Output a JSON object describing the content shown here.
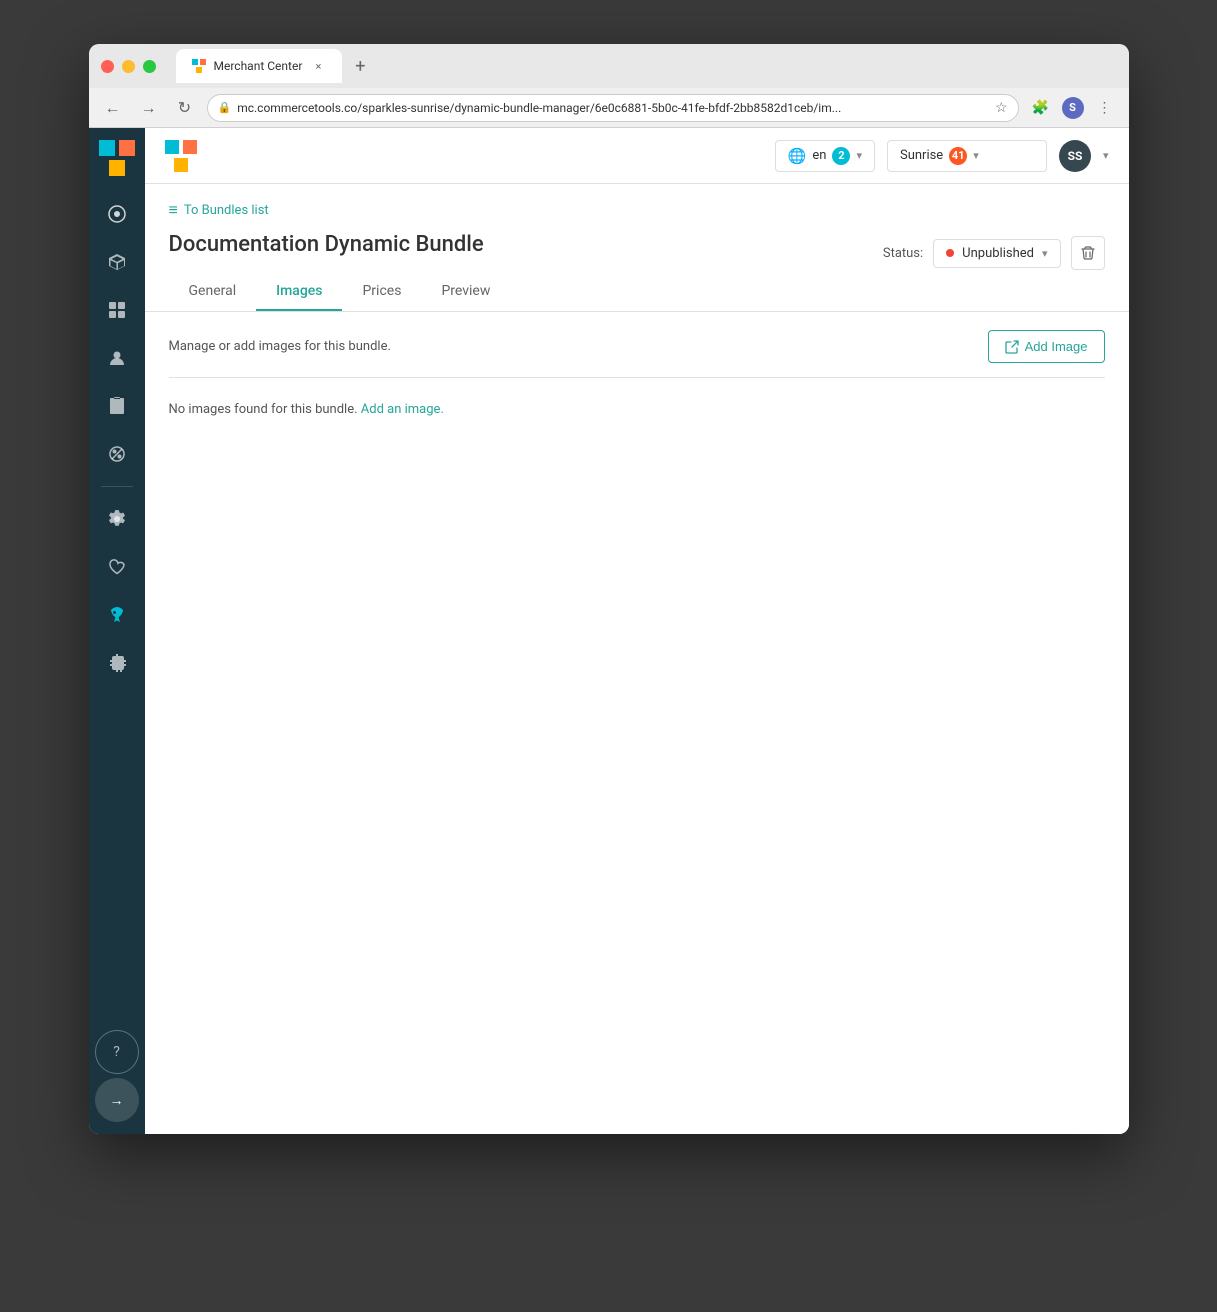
{
  "browser": {
    "tab_title": "Merchant Center",
    "url": "mc.commercetools.co/sparkles-sunrise/dynamic-bundle-manager/6e0c6881-5b0c-41fe-bfdf-2bb8582d1ceb/im...",
    "tab_close": "×",
    "tab_new": "+"
  },
  "topnav": {
    "lang": "en",
    "lang_count": "2",
    "project_name": "Sunrise",
    "project_count": "41",
    "user_initials": "SS"
  },
  "breadcrumb": {
    "icon": "≡",
    "label": "To Bundles list"
  },
  "page": {
    "title": "Documentation Dynamic Bundle",
    "tabs": [
      {
        "id": "general",
        "label": "General"
      },
      {
        "id": "images",
        "label": "Images"
      },
      {
        "id": "prices",
        "label": "Prices"
      },
      {
        "id": "preview",
        "label": "Preview"
      }
    ],
    "active_tab": "images",
    "status_label": "Status:",
    "status_value": "Unpublished",
    "body_description": "Manage or add images for this bundle.",
    "add_image_label": "Add Image",
    "empty_state": "No images found for this bundle.",
    "empty_link": "Add an image."
  },
  "sidebar": {
    "items": [
      {
        "id": "dashboard",
        "icon": "◉",
        "label": "Dashboard"
      },
      {
        "id": "products",
        "icon": "⬡",
        "label": "Products"
      },
      {
        "id": "categories",
        "icon": "⊞",
        "label": "Categories"
      },
      {
        "id": "customers",
        "icon": "👤",
        "label": "Customers"
      },
      {
        "id": "orders",
        "icon": "🛒",
        "label": "Orders"
      },
      {
        "id": "discounts",
        "icon": "🏷",
        "label": "Discounts"
      }
    ],
    "bottom_items": [
      {
        "id": "settings",
        "icon": "⚙",
        "label": "Settings"
      },
      {
        "id": "wishlist",
        "icon": "♥",
        "label": "Wishlist"
      },
      {
        "id": "launch",
        "icon": "🚀",
        "label": "Launch"
      },
      {
        "id": "extensions",
        "icon": "📎",
        "label": "Extensions"
      }
    ],
    "help": "?",
    "forward": "→"
  }
}
